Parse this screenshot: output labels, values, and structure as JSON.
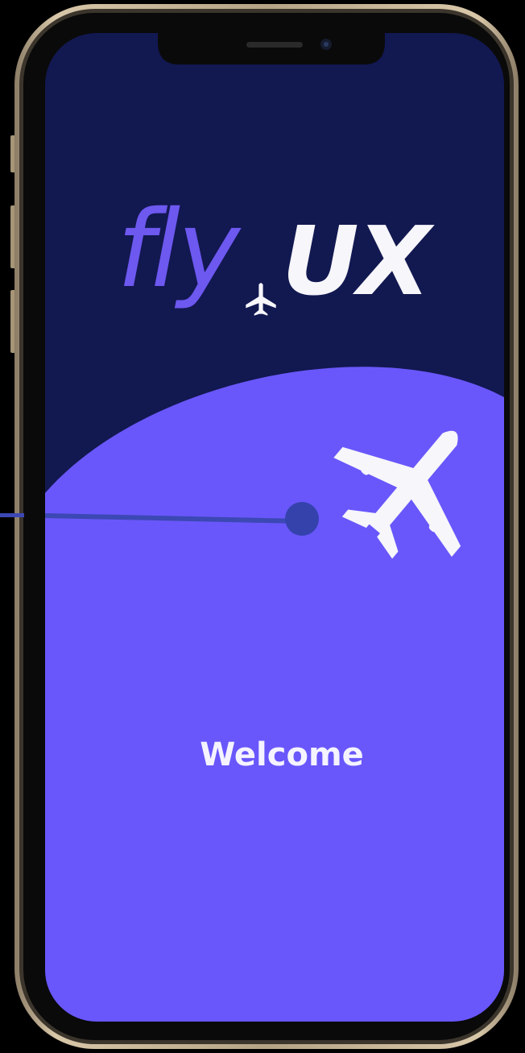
{
  "app": {
    "logo_part1": "fly",
    "logo_part2": "UX"
  },
  "screen": {
    "welcome_text": "Welcome"
  },
  "icons": {
    "logo_icon": "airplane-icon",
    "hero_icon": "airplane-icon",
    "flight_path": "flight-path-line"
  },
  "colors": {
    "frame_outer": "#b8a586",
    "bezel": "#0a0a0a",
    "screen_top": "#121850",
    "screen_bottom": "#6957fb",
    "logo_accent": "#6d58f0",
    "logo_white": "#f6f6fb",
    "path_line": "#3c48b4",
    "path_dot": "#3542ac",
    "welcome_text": "#f4f3ff"
  }
}
